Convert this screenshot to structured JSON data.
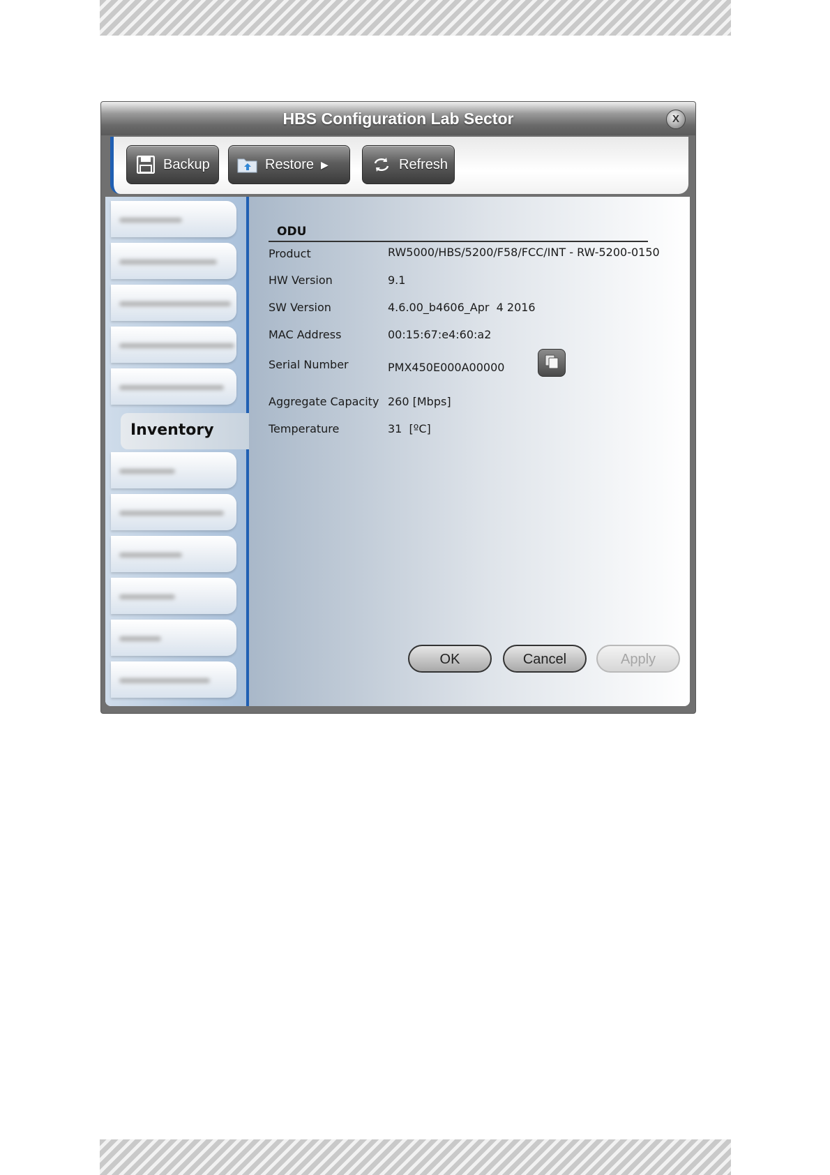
{
  "window": {
    "title": "HBS Configuration Lab Sector",
    "close_label": "X"
  },
  "toolbar": {
    "backup_label": "Backup",
    "restore_label": "Restore",
    "refresh_label": "Refresh"
  },
  "sidebar": {
    "active_item": "Inventory"
  },
  "section": {
    "title": "ODU"
  },
  "inventory": {
    "product_label": "Product",
    "product_value": "RW5000/HBS/5200/F58/FCC/INT - RW-5200-0150",
    "hw_label": "HW Version",
    "hw_value": "9.1",
    "sw_label": "SW Version",
    "sw_value": "4.6.00_b4606_Apr  4 2016",
    "mac_label": "MAC Address",
    "mac_value": "00:15:67:e4:60:a2",
    "serial_label": "Serial Number",
    "serial_value": "PMX450E000A00000",
    "capacity_label": "Aggregate Capacity",
    "capacity_value": "260 [Mbps]",
    "temp_label": "Temperature",
    "temp_value": "31  [ºC]"
  },
  "buttons": {
    "ok_label": "OK",
    "cancel_label": "Cancel",
    "apply_label": "Apply"
  }
}
